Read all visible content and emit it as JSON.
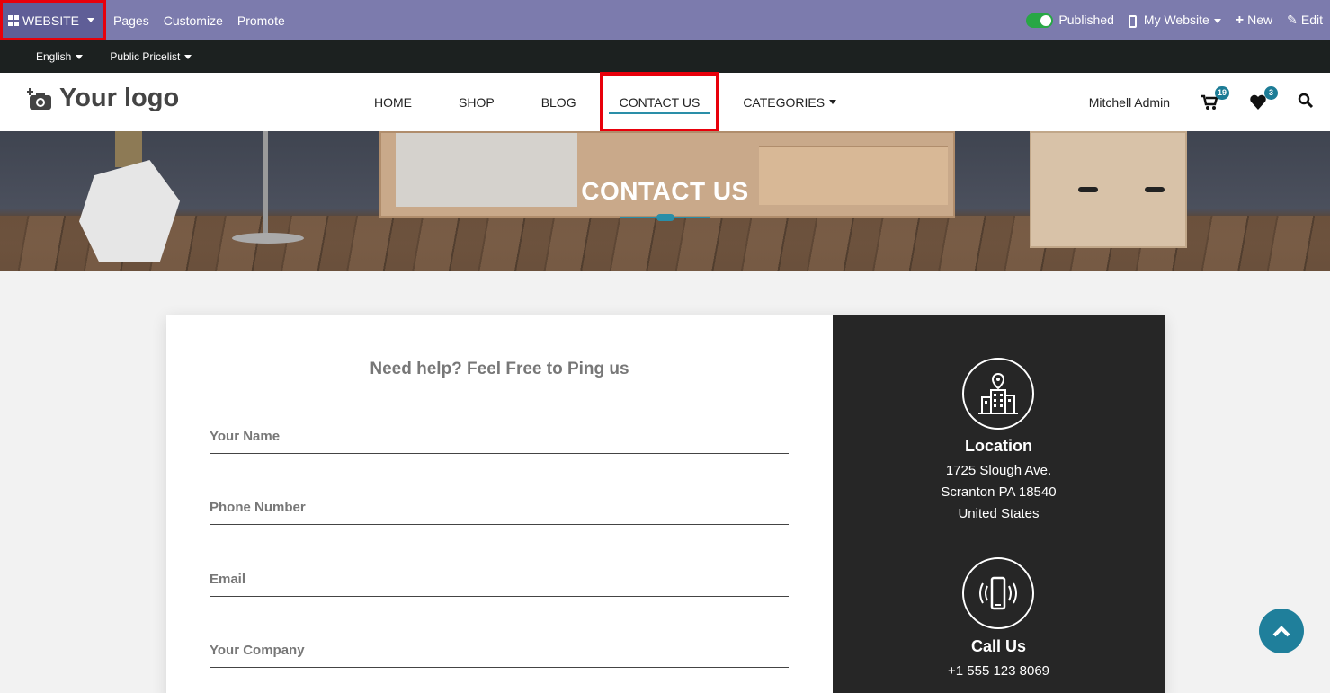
{
  "admin_bar": {
    "app_label": "WEBSITE",
    "menu": [
      "Pages",
      "Customize",
      "Promote"
    ],
    "published_label": "Published",
    "site_label": "My Website",
    "new_label": "New",
    "edit_label": "Edit",
    "published_on": true
  },
  "sub_bar": {
    "language": "English",
    "pricelist": "Public Pricelist"
  },
  "header": {
    "logo_text": "Your logo",
    "nav": [
      "HOME",
      "SHOP",
      "BLOG",
      "CONTACT US",
      "CATEGORIES"
    ],
    "active_nav": "CONTACT US",
    "user": "Mitchell Admin",
    "cart_count": "19",
    "wishlist_count": "3"
  },
  "hero": {
    "title": "CONTACT US"
  },
  "form": {
    "heading": "Need help? Feel Free to Ping us",
    "fields": [
      "Your Name",
      "Phone Number",
      "Email",
      "Your Company"
    ]
  },
  "info": {
    "location_title": "Location",
    "address": [
      "1725 Slough Ave.",
      "Scranton PA 18540",
      "United States"
    ],
    "call_title": "Call Us",
    "phone": "+1 555 123 8069"
  },
  "colors": {
    "admin_bar": "#7c7bad",
    "accent": "#1f7f9b",
    "highlight": "#e8000b",
    "dark_panel": "#262626"
  }
}
